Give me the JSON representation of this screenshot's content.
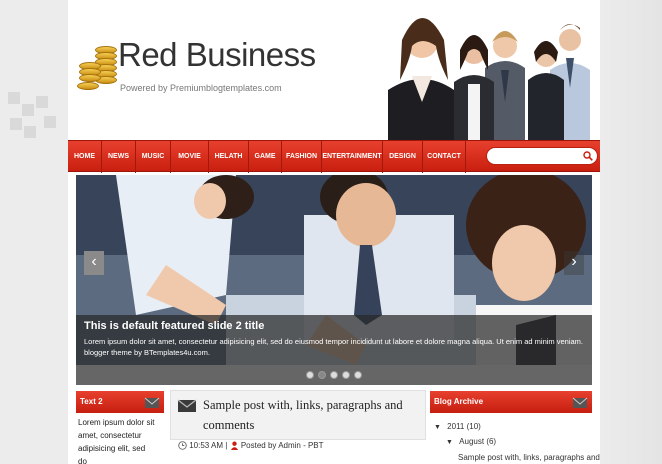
{
  "header": {
    "title": "Red Business",
    "subtitle": "Powered by Premiumblogtemplates.com"
  },
  "nav": {
    "items": [
      "HOME",
      "NEWS",
      "MUSIC",
      "MOVIE",
      "HELATH",
      "GAME",
      "FASHION",
      "ENTERTAINMENT",
      "DESIGN",
      "CONTACT"
    ],
    "search_placeholder": ""
  },
  "slider": {
    "title": "This is default featured slide 2 title",
    "text": "Lorem ipsum dolor sit amet, consectetur adipisicing elit, sed do eiusmod tempor incididunt ut labore et dolore magna aliqua. Ut enim ad minim veniam. blogger theme by BTemplates4u.com.",
    "prev_arrow": "‹",
    "next_arrow": "›",
    "dot_count": 5,
    "active_dot": 1
  },
  "left_widget": {
    "title": "Text 2",
    "text": "Lorem ipsum dolor sit amet, consectetur adipisicing elit, sed do"
  },
  "post": {
    "title": "Sample post with, links, paragraphs and comments",
    "time": "10:53 AM",
    "separator": "|",
    "author": "Posted by Admin - PBT"
  },
  "archive": {
    "title": "Blog Archive",
    "year": "2011",
    "year_count": "(10)",
    "month": "August",
    "month_count": "(6)",
    "post": "Sample post with, links, paragraphs and"
  },
  "colors": {
    "accent": "#d42a18",
    "nav_border": "#9c1508",
    "text_dark": "#333333"
  }
}
